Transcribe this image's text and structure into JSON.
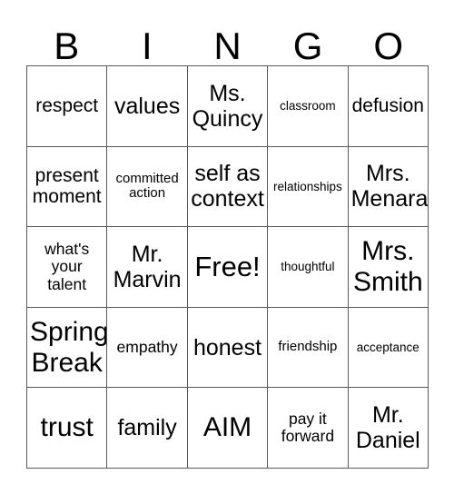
{
  "card": {
    "title": "Bingo Card",
    "header_letters": [
      "B",
      "I",
      "N",
      "G",
      "O"
    ],
    "border_color": "#595959",
    "background_color": "#ffffff",
    "text_color": "#000000",
    "columns": 5,
    "rows": 5,
    "cells": [
      {
        "text": "respect",
        "size": "lg"
      },
      {
        "text": "values",
        "size": "xl"
      },
      {
        "text": "Ms.\nQuincy",
        "size": "xl"
      },
      {
        "text": "classroom",
        "size": "xs"
      },
      {
        "text": "defusion",
        "size": "lg"
      },
      {
        "text": "present\nmoment",
        "size": "lg"
      },
      {
        "text": "committed\naction",
        "size": "sm"
      },
      {
        "text": "self as\ncontext",
        "size": "xl"
      },
      {
        "text": "relationships",
        "size": "xs"
      },
      {
        "text": "Mrs.\nMenara",
        "size": "xl"
      },
      {
        "text": "what's\nyour\ntalent",
        "size": "md"
      },
      {
        "text": "Mr.\nMarvin",
        "size": "xl"
      },
      {
        "text": "Free!",
        "size": "free"
      },
      {
        "text": "thoughtful",
        "size": "xs"
      },
      {
        "text": "Mrs.\nSmith",
        "size": "xxl"
      },
      {
        "text": "Spring\nBreak",
        "size": "xxl"
      },
      {
        "text": "empathy",
        "size": "md"
      },
      {
        "text": "honest",
        "size": "xl"
      },
      {
        "text": "friendship",
        "size": "sm"
      },
      {
        "text": "acceptance",
        "size": "xs"
      },
      {
        "text": "trust",
        "size": "xxl"
      },
      {
        "text": "family",
        "size": "xl"
      },
      {
        "text": "AIM",
        "size": "xxl"
      },
      {
        "text": "pay it\nforward",
        "size": "md"
      },
      {
        "text": "Mr.\nDaniel",
        "size": "xl"
      }
    ]
  }
}
